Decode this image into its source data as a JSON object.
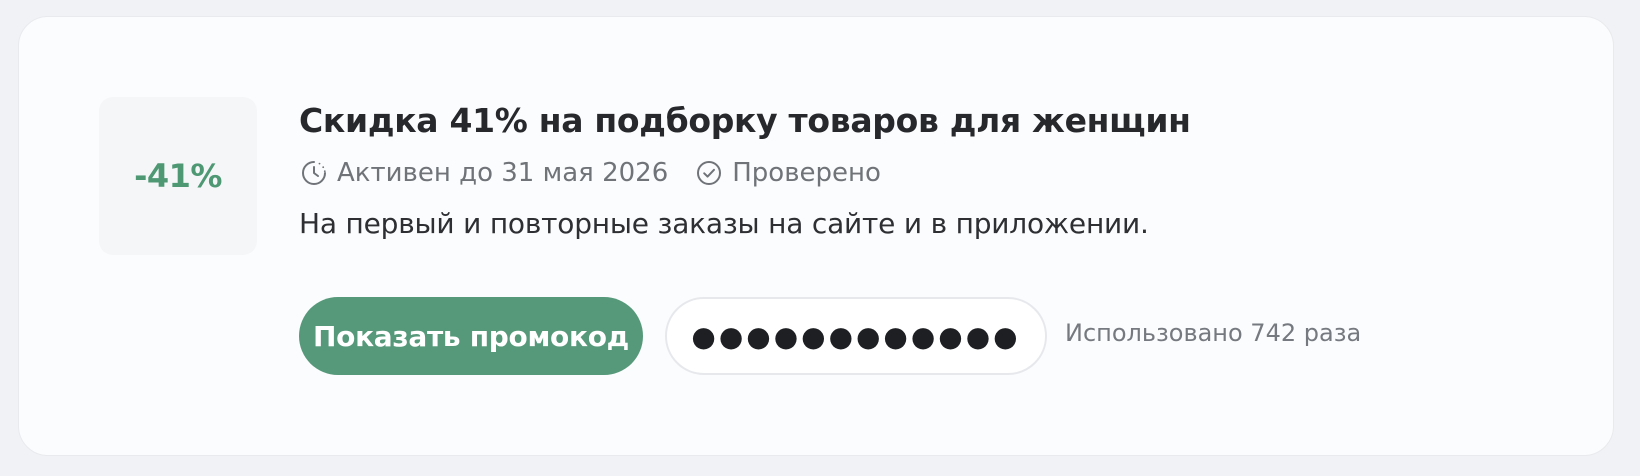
{
  "promo": {
    "discount_badge": "-41%",
    "title": "Скидка 41% на подборку товаров для женщин",
    "active_until": "Активен до 31 мая 2026",
    "verified": "Проверено",
    "description": "На первый и повторные заказы на сайте и в приложении.",
    "show_code_label": "Показать промокод",
    "masked_code": "●●●●●●●●●●●●",
    "usage_text": "Использовано 742 раза"
  },
  "icons": {
    "active_until": "clock-icon",
    "verified": "check-circle-icon"
  },
  "colors": {
    "accent": "#56997a",
    "discount_text": "#4e9874",
    "muted_text": "#707479",
    "title_text": "#26282c"
  }
}
